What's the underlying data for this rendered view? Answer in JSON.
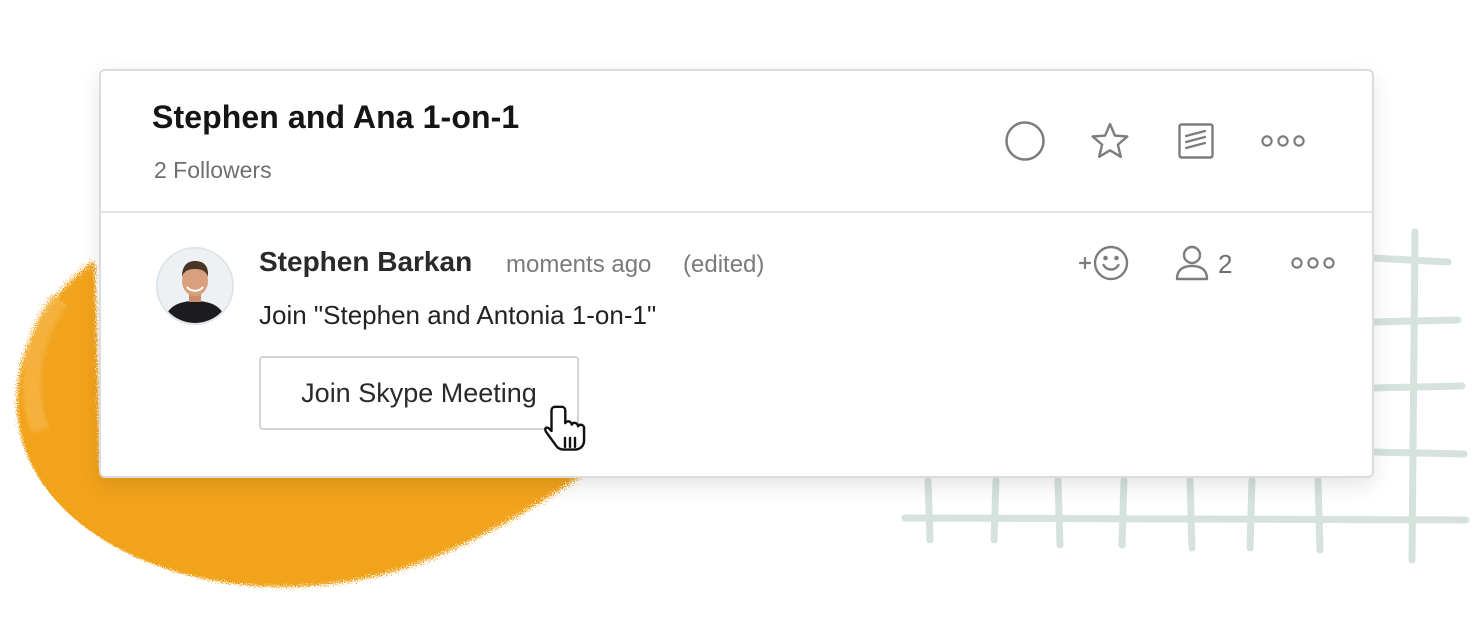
{
  "header": {
    "title": "Stephen and Ana 1-on-1",
    "followers": "2 Followers",
    "actions": [
      "complete-circle-icon",
      "star-icon",
      "note-icon",
      "more-horizontal-icon"
    ]
  },
  "comment": {
    "author": "Stephen Barkan",
    "timestamp": "moments ago",
    "edited": "(edited)",
    "text": "Join \"Stephen and Antonia 1-on-1\"",
    "button_label": "Join Skype Meeting",
    "follower_count": "2",
    "actions": [
      "add-reaction-icon",
      "person-icon",
      "more-horizontal-icon"
    ]
  },
  "colors": {
    "accent_orange": "#f2a31c",
    "grid_green": "#d6e2dc",
    "icon_gray": "#7d7d7d"
  }
}
